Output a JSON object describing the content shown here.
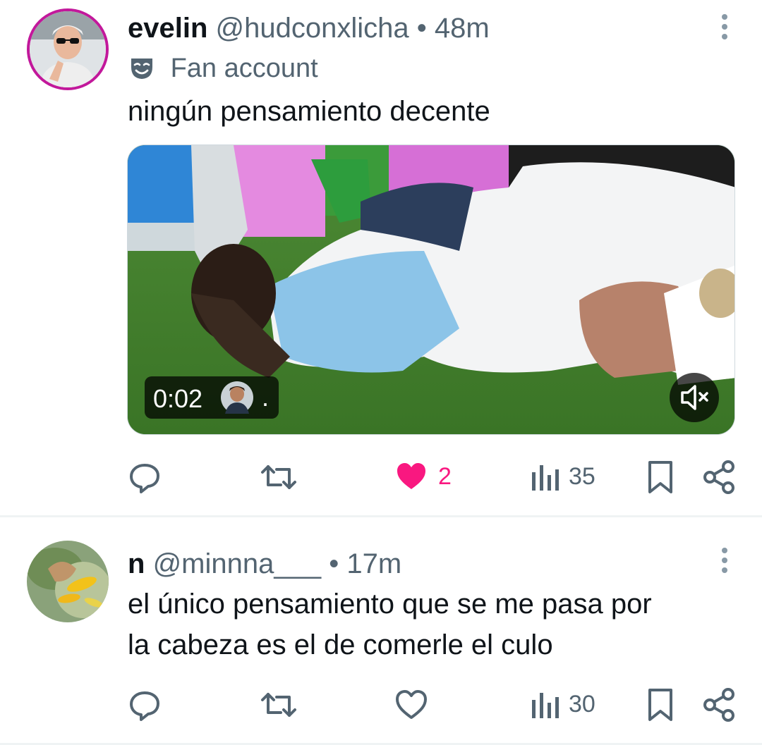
{
  "tweets": [
    {
      "display_name": "evelin",
      "handle": "@hudconxlicha",
      "separator": "•",
      "time": "48m",
      "label": "Fan account",
      "text": [
        "ningún pensamiento decente"
      ],
      "media": {
        "duration": "0:02",
        "attribution_dot": "."
      },
      "actions": {
        "reply": "",
        "retweet": "",
        "likes": "2",
        "views": "35"
      },
      "liked": true
    },
    {
      "display_name": "n",
      "handle": "@minnna___",
      "separator": "•",
      "time": "17m",
      "text": [
        "el único pensamiento que se me pasa por",
        "la cabeza es el de comerle el culo"
      ],
      "actions": {
        "reply": "",
        "retweet": "",
        "likes": "",
        "views": "30"
      },
      "liked": false
    }
  ],
  "colors": {
    "like_active": "#f91880",
    "text_secondary": "#536471",
    "avatar_ring": "#c2189b"
  },
  "icons": [
    "reply-icon",
    "retweet-icon",
    "heart-icon",
    "views-icon",
    "bookmark-icon",
    "share-icon",
    "mask-icon",
    "mute-icon",
    "more-icon"
  ]
}
